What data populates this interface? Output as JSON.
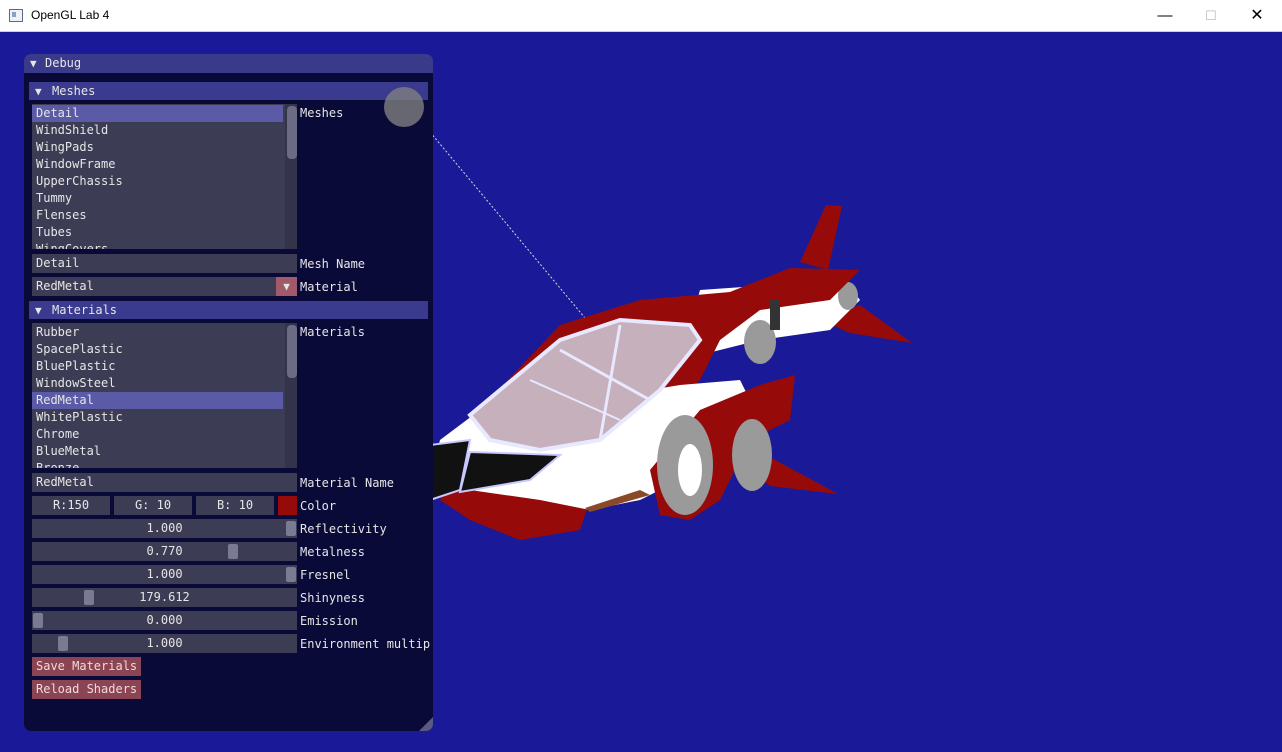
{
  "window": {
    "title": "OpenGL Lab 4",
    "controls": {
      "minimize": "—",
      "maximize": "☐",
      "close": "✕"
    }
  },
  "colors": {
    "viewport_bg": "#1a1a99",
    "panel_bg": "#0a0a38",
    "header_bg": "#3a3a8a",
    "selected_item": "#5a5aa6",
    "button_bg": "#8a4454",
    "material_color": "#960a0a"
  },
  "debug": {
    "title": "Debug",
    "meshes": {
      "header": "Meshes",
      "list_label": "Meshes",
      "items": [
        "Detail",
        "WindShield",
        "WingPads",
        "WindowFrame",
        "UpperChassis",
        "Tummy",
        "Flenses",
        "Tubes",
        "WingCovers"
      ],
      "selected_index": 0,
      "mesh_name_value": "Detail",
      "mesh_name_label": "Mesh Name",
      "material_value": "RedMetal",
      "material_label": "Material"
    },
    "materials": {
      "header": "Materials",
      "list_label": "Materials",
      "items": [
        "Rubber",
        "SpacePlastic",
        "BluePlastic",
        "WindowSteel",
        "RedMetal",
        "WhitePlastic",
        "Chrome",
        "BlueMetal",
        "Bronze"
      ],
      "selected_index": 4,
      "material_name_value": "RedMetal",
      "material_name_label": "Material Name",
      "color": {
        "r": "R:150",
        "g": "G: 10",
        "b": "B: 10",
        "label": "Color",
        "r_value": 150,
        "g_value": 10,
        "b_value": 10
      },
      "sliders": [
        {
          "label": "Reflectivity",
          "value": "1.000",
          "fraction": 1.0
        },
        {
          "label": "Metalness",
          "value": "0.770",
          "fraction": 0.77
        },
        {
          "label": "Fresnel",
          "value": "1.000",
          "fraction": 1.0
        },
        {
          "label": "Shinyness",
          "value": "179.612",
          "fraction": 0.2
        },
        {
          "label": "Emission",
          "value": "0.000",
          "fraction": 0.0
        },
        {
          "label": "Environment multip",
          "value": "1.000",
          "fraction": 0.1
        }
      ],
      "save_button": "Save Materials",
      "reload_button": "Reload Shaders"
    }
  },
  "scene": {
    "object": "spaceship-model"
  }
}
